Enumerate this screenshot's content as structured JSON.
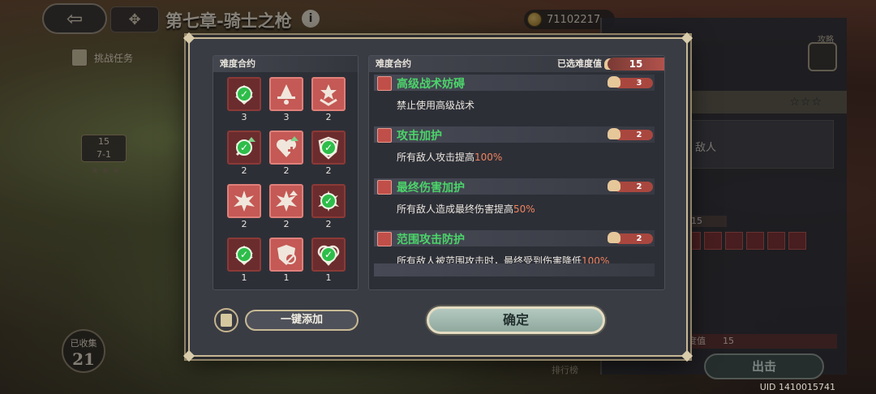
{
  "topbar": {
    "back_icon": "back-arrow-icon",
    "chapter_title": "第七章-骑士之枪",
    "info_icon": "i",
    "currency_value": "71102217"
  },
  "map": {
    "challenge_label": "挑战任务",
    "node_level": "15",
    "node_stage": "7-1",
    "node_stars": "★★★",
    "collected_label": "已收集",
    "collected_count": "21"
  },
  "side_panel": {
    "guide_label": "攻略",
    "enemy_text": "敌人",
    "difficulty_value": "15",
    "difficulty_label": "度值",
    "difficulty_num": "15",
    "go_button": "出击",
    "stars": "☆☆☆",
    "rank_label": "排行榜"
  },
  "modal": {
    "left_title": "难度合约",
    "right_title": "难度合约",
    "selected_label": "已选难度值",
    "selected_value": "15",
    "contracts": [
      {
        "icon": "arrow-down-icon",
        "cost": "3",
        "checked": true
      },
      {
        "icon": "wizard-hat-icon",
        "cost": "3",
        "checked": false
      },
      {
        "icon": "chevron-star-icon",
        "cost": "2",
        "checked": false
      },
      {
        "icon": "sword-up-icon",
        "cost": "2",
        "checked": true
      },
      {
        "icon": "heart-plus-icon",
        "cost": "2",
        "checked": false
      },
      {
        "icon": "shield-icon",
        "cost": "2",
        "checked": true
      },
      {
        "icon": "burst-icon",
        "cost": "2",
        "checked": false
      },
      {
        "icon": "burst-arrow-icon",
        "cost": "2",
        "checked": false
      },
      {
        "icon": "burst-check-icon",
        "cost": "2",
        "checked": true
      },
      {
        "icon": "arrow-down-icon",
        "cost": "1",
        "checked": true
      },
      {
        "icon": "no-heal-icon",
        "cost": "1",
        "checked": false
      },
      {
        "icon": "heart-shield-icon",
        "cost": "1",
        "checked": true
      }
    ],
    "entries": [
      {
        "name": "高级战术妨碍",
        "cost": "3",
        "desc_pre": "禁止使用高级战术",
        "desc_hl": ""
      },
      {
        "name": "攻击加护",
        "cost": "2",
        "desc_pre": "所有敌人攻击提高",
        "desc_hl": "100%"
      },
      {
        "name": "最终伤害加护",
        "cost": "2",
        "desc_pre": "所有敌人造成最终伤害提高",
        "desc_hl": "50%"
      },
      {
        "name": "范围攻击防护",
        "cost": "2",
        "desc_pre": "所有敌人被范围攻击时，最终受到伤害降低",
        "desc_hl": "100%"
      }
    ],
    "add_all_button": "一键添加",
    "confirm_button": "确定"
  },
  "uid_label": "UID 1410015741",
  "colors": {
    "check_green": "#2ebd4a",
    "tile_red": "#c45955",
    "tile_dark_red": "#6b2c2e",
    "entry_green": "#4bd46a",
    "highlight_orange": "#f0845e"
  }
}
